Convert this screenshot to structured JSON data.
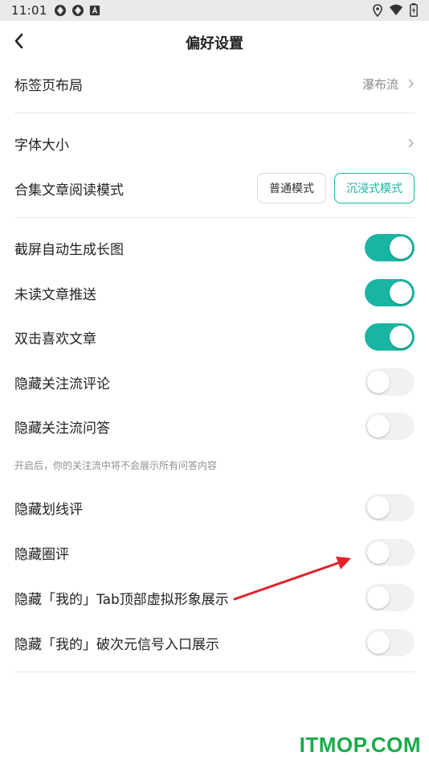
{
  "status_bar": {
    "time": "11:01"
  },
  "header": {
    "title": "偏好设置"
  },
  "settings": {
    "tab_layout": {
      "label": "标签页布局",
      "value": "瀑布流"
    },
    "font_size": {
      "label": "字体大小"
    },
    "reading_mode": {
      "label": "合集文章阅读模式",
      "options": [
        "普通模式",
        "沉浸式模式"
      ],
      "selected": "沉浸式模式"
    },
    "toggles": [
      {
        "label": "截屏自动生成长图",
        "on": true
      },
      {
        "label": "未读文章推送",
        "on": true
      },
      {
        "label": "双击喜欢文章",
        "on": true
      },
      {
        "label": "隐藏关注流评论",
        "on": false
      },
      {
        "label": "隐藏关注流问答",
        "on": false
      },
      {
        "label": "隐藏划线评",
        "on": false
      },
      {
        "label": "隐藏圈评",
        "on": false
      },
      {
        "label": "隐藏「我的」Tab顶部虚拟形象展示",
        "on": false
      },
      {
        "label": "隐藏「我的」破次元信号入口展示",
        "on": false
      }
    ],
    "qa_hint": "开启后，你的关注流中将不会展示所有问答内容"
  },
  "watermark": "ITMOP.COM",
  "colors": {
    "accent": "#1ab4a3",
    "annotation_arrow": "#e0242b"
  }
}
